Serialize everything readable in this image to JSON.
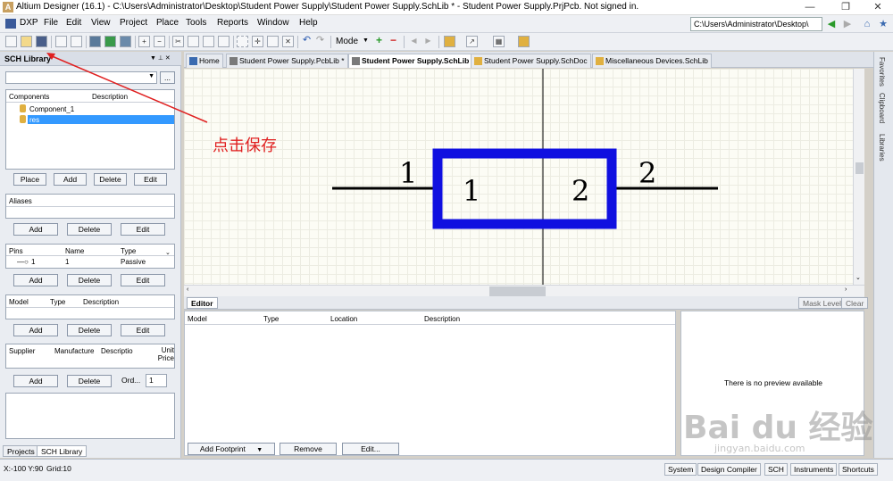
{
  "window": {
    "title": "Altium Designer (16.1) - C:\\Users\\Administrator\\Desktop\\Student Power Supply\\Student Power Supply.SchLib * - Student Power Supply.PrjPcb. Not signed in.",
    "minimize": "—",
    "restore": "❐",
    "close": "✕"
  },
  "menu": {
    "items": [
      "DXP",
      "File",
      "Edit",
      "View",
      "Project",
      "Place",
      "Tools",
      "Reports",
      "Window",
      "Help"
    ],
    "path": "C:\\Users\\Administrator\\Desktop\\"
  },
  "toolbar": {
    "mode_label": "Mode"
  },
  "left_panel": {
    "title": "SCH Library",
    "components": {
      "headers": [
        "Components",
        "Description"
      ],
      "rows": [
        {
          "name": "Component_1",
          "selected": false
        },
        {
          "name": "res",
          "selected": true
        }
      ],
      "buttons": [
        "Place",
        "Add",
        "Delete",
        "Edit"
      ]
    },
    "aliases": {
      "header": "Aliases",
      "buttons": [
        "Add",
        "Delete",
        "Edit"
      ]
    },
    "pins": {
      "headers": [
        "Pins",
        "Name",
        "Type"
      ],
      "rows": [
        {
          "pin": "1",
          "name": "1",
          "type": "Passive"
        }
      ],
      "buttons": [
        "Add",
        "Delete",
        "Edit"
      ]
    },
    "model": {
      "headers": [
        "Model",
        "Type",
        "Description"
      ],
      "buttons": [
        "Add",
        "Delete",
        "Edit"
      ]
    },
    "supplier": {
      "headers": [
        "Supplier",
        "Manufacture",
        "Descriptio",
        "Unit Price"
      ],
      "buttons": [
        "Add",
        "Delete"
      ],
      "order_label": "Ord...",
      "order_value": "1"
    },
    "tabs": [
      "Projects",
      "SCH Library"
    ]
  },
  "doc_tabs": [
    {
      "label": "Home",
      "active": false
    },
    {
      "label": "Student Power Supply.PcbLib *",
      "active": false
    },
    {
      "label": "Student Power Supply.SchLib *",
      "active": true
    },
    {
      "label": "Student Power Supply.SchDoc",
      "active": false
    },
    {
      "label": "Miscellaneous Devices.SchLib",
      "active": false
    }
  ],
  "canvas": {
    "pin_left_number": "1",
    "pin_left_name": "1",
    "pin_right_number": "2",
    "pin_right_name": "2",
    "body_color": "#1010e0"
  },
  "annotation": {
    "text": "点击保存",
    "color": "#e02020"
  },
  "right_bar": {
    "tabs": [
      "Favorites",
      "Clipboard",
      "Libraries"
    ]
  },
  "editor": {
    "tab": "Editor",
    "mask_level": "Mask Level",
    "clear": "Clear",
    "headers": [
      "Model",
      "Type",
      "Location",
      "Description"
    ],
    "buttons": [
      "Add Footprint",
      "Remove",
      "Edit..."
    ],
    "preview_text": "There is no preview available"
  },
  "status": {
    "coords": "X:-100 Y:90",
    "grid": "Grid:10",
    "buttons": [
      "System",
      "Design Compiler",
      "SCH",
      "Instruments",
      "Shortcuts"
    ]
  },
  "watermark": {
    "logo": "Bai du 经验",
    "url": "jingyan.baidu.com"
  }
}
